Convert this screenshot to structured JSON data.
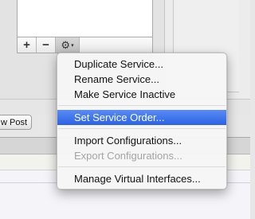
{
  "list_toolbar": {
    "add_label": "+",
    "remove_label": "−",
    "action_icon": "gear-icon",
    "action_icon_glyph": "⚙",
    "chevron_glyph": "▾"
  },
  "background": {
    "post_button_label": "w Post"
  },
  "context_menu": {
    "groups": [
      [
        {
          "label": "Duplicate Service...",
          "state": "enabled"
        },
        {
          "label": "Rename Service...",
          "state": "enabled"
        },
        {
          "label": "Make Service Inactive",
          "state": "enabled"
        }
      ],
      [
        {
          "label": "Set Service Order...",
          "state": "highlighted"
        }
      ],
      [
        {
          "label": "Import Configurations...",
          "state": "enabled"
        },
        {
          "label": "Export Configurations...",
          "state": "disabled"
        }
      ],
      [
        {
          "label": "Manage Virtual Interfaces...",
          "state": "enabled"
        }
      ]
    ],
    "highlight_color": "#3a73ea"
  }
}
